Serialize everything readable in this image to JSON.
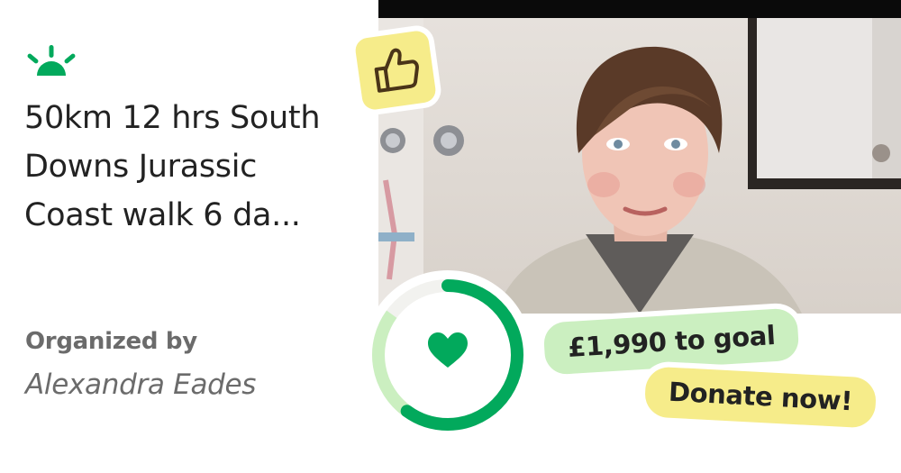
{
  "campaign": {
    "title_lines": [
      "50km 12 hrs South",
      "Downs Jurassic",
      "Coast walk 6 da..."
    ]
  },
  "organizer": {
    "label": "Organized by",
    "name": "Alexandra Eades"
  },
  "fundraising": {
    "remaining_text": "£1,990 to goal",
    "progress_fraction": 0.6
  },
  "actions": {
    "donate_label": "Donate now!"
  },
  "icons": {
    "logo": "sunrise-logo-icon",
    "thumb": "thumbs-up-icon",
    "heart": "heart-icon"
  },
  "colors": {
    "brand_green": "#02a95c",
    "light_green": "#cbefc0",
    "yellow": "#f6ec8a",
    "text_dark": "#222222",
    "text_gray": "#6b6b6b"
  }
}
